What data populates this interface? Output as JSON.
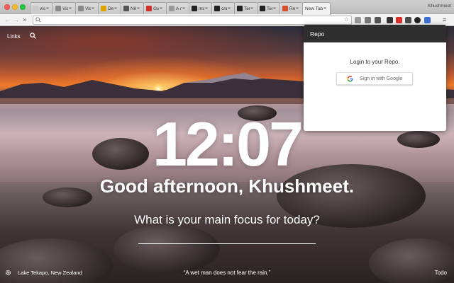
{
  "browser": {
    "tabs": [
      {
        "title": "visio",
        "color": "#c9c9c9"
      },
      {
        "title": "Visu",
        "color": "#8a8a8a"
      },
      {
        "title": "Visu",
        "color": "#8a8a8a"
      },
      {
        "title": "Deep",
        "color": "#d9a400"
      },
      {
        "title": "Nikh",
        "color": "#555555"
      },
      {
        "title": "Guid",
        "color": "#d4322c"
      },
      {
        "title": "A ne",
        "color": "#9a9a9a"
      },
      {
        "title": "mari",
        "color": "#222222"
      },
      {
        "title": "cnn",
        "color": "#222222"
      },
      {
        "title": "Tens",
        "color": "#222222"
      },
      {
        "title": "Tens",
        "color": "#222222"
      },
      {
        "title": "Repo",
        "color": "#d9502c"
      },
      {
        "title": "New Tab",
        "color": "#f2f2f2",
        "active": true
      }
    ],
    "close_glyph": "×",
    "profile_name": "Khushmeet",
    "address_value": "",
    "address_placeholder": ""
  },
  "app": {
    "links_label": "Links",
    "clock": "12:07",
    "greeting": "Good afternoon, Khushmeet.",
    "focus_question": "What is your main focus for today?",
    "location": "Lake Tekapo, New Zealand",
    "quote": "“A wet man does not fear the rain.”",
    "todo_label": "Todo"
  },
  "popup": {
    "title": "Repo",
    "login_text": "Login to your Repo.",
    "google_button": "Sign in with Google"
  },
  "icons": {
    "back": "back-arrow-icon",
    "forward": "forward-arrow-icon",
    "reload": "close-icon",
    "search": "search-icon",
    "settings": "gear-icon",
    "google": "google-logo-icon"
  }
}
